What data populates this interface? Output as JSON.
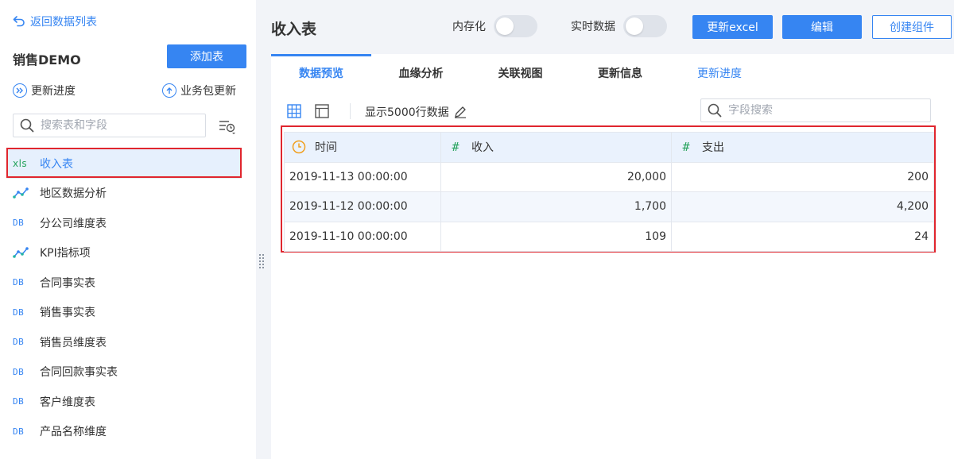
{
  "sidebar": {
    "back_label": "返回数据列表",
    "project_title": "销售DEMO",
    "add_button": "添加表",
    "update_progress": "更新进度",
    "package_update": "业务包更新",
    "search_placeholder": "搜索表和字段",
    "items": [
      {
        "type": "xls",
        "type_label": "xls",
        "label": "收入表",
        "active": true
      },
      {
        "type": "analysis",
        "type_label": "",
        "label": "地区数据分析"
      },
      {
        "type": "db",
        "type_label": "DB",
        "label": "分公司维度表"
      },
      {
        "type": "analysis",
        "type_label": "",
        "label": "KPI指标项"
      },
      {
        "type": "db",
        "type_label": "DB",
        "label": "合同事实表"
      },
      {
        "type": "db",
        "type_label": "DB",
        "label": "销售事实表"
      },
      {
        "type": "db",
        "type_label": "DB",
        "label": "销售员维度表"
      },
      {
        "type": "db",
        "type_label": "DB",
        "label": "合同回款事实表"
      },
      {
        "type": "db",
        "type_label": "DB",
        "label": "客户维度表"
      },
      {
        "type": "db",
        "type_label": "DB",
        "label": "产品名称维度"
      }
    ]
  },
  "header": {
    "title": "收入表",
    "in_memory_label": "内存化",
    "realtime_label": "实时数据",
    "update_excel": "更新excel",
    "edit": "编辑",
    "create_component": "创建组件"
  },
  "tabs": [
    {
      "label": "数据预览",
      "active": true
    },
    {
      "label": "血缘分析"
    },
    {
      "label": "关联视图"
    },
    {
      "label": "更新信息"
    },
    {
      "label": "更新进度",
      "link": true
    }
  ],
  "toolbar": {
    "row_limit_label": "显示5000行数据",
    "field_search_placeholder": "字段搜索"
  },
  "table": {
    "columns": [
      {
        "label": "时间",
        "type": "date"
      },
      {
        "label": "收入",
        "type": "number"
      },
      {
        "label": "支出",
        "type": "number"
      }
    ],
    "rows": [
      [
        "2019-11-13 00:00:00",
        "20,000",
        "200"
      ],
      [
        "2019-11-12 00:00:00",
        "1,700",
        "4,200"
      ],
      [
        "2019-11-10 00:00:00",
        "109",
        "24"
      ]
    ]
  },
  "colors": {
    "accent": "#3685f2",
    "excel_green": "#27a35d",
    "highlight_red": "#e0262e",
    "clock_orange": "#f0a020"
  }
}
